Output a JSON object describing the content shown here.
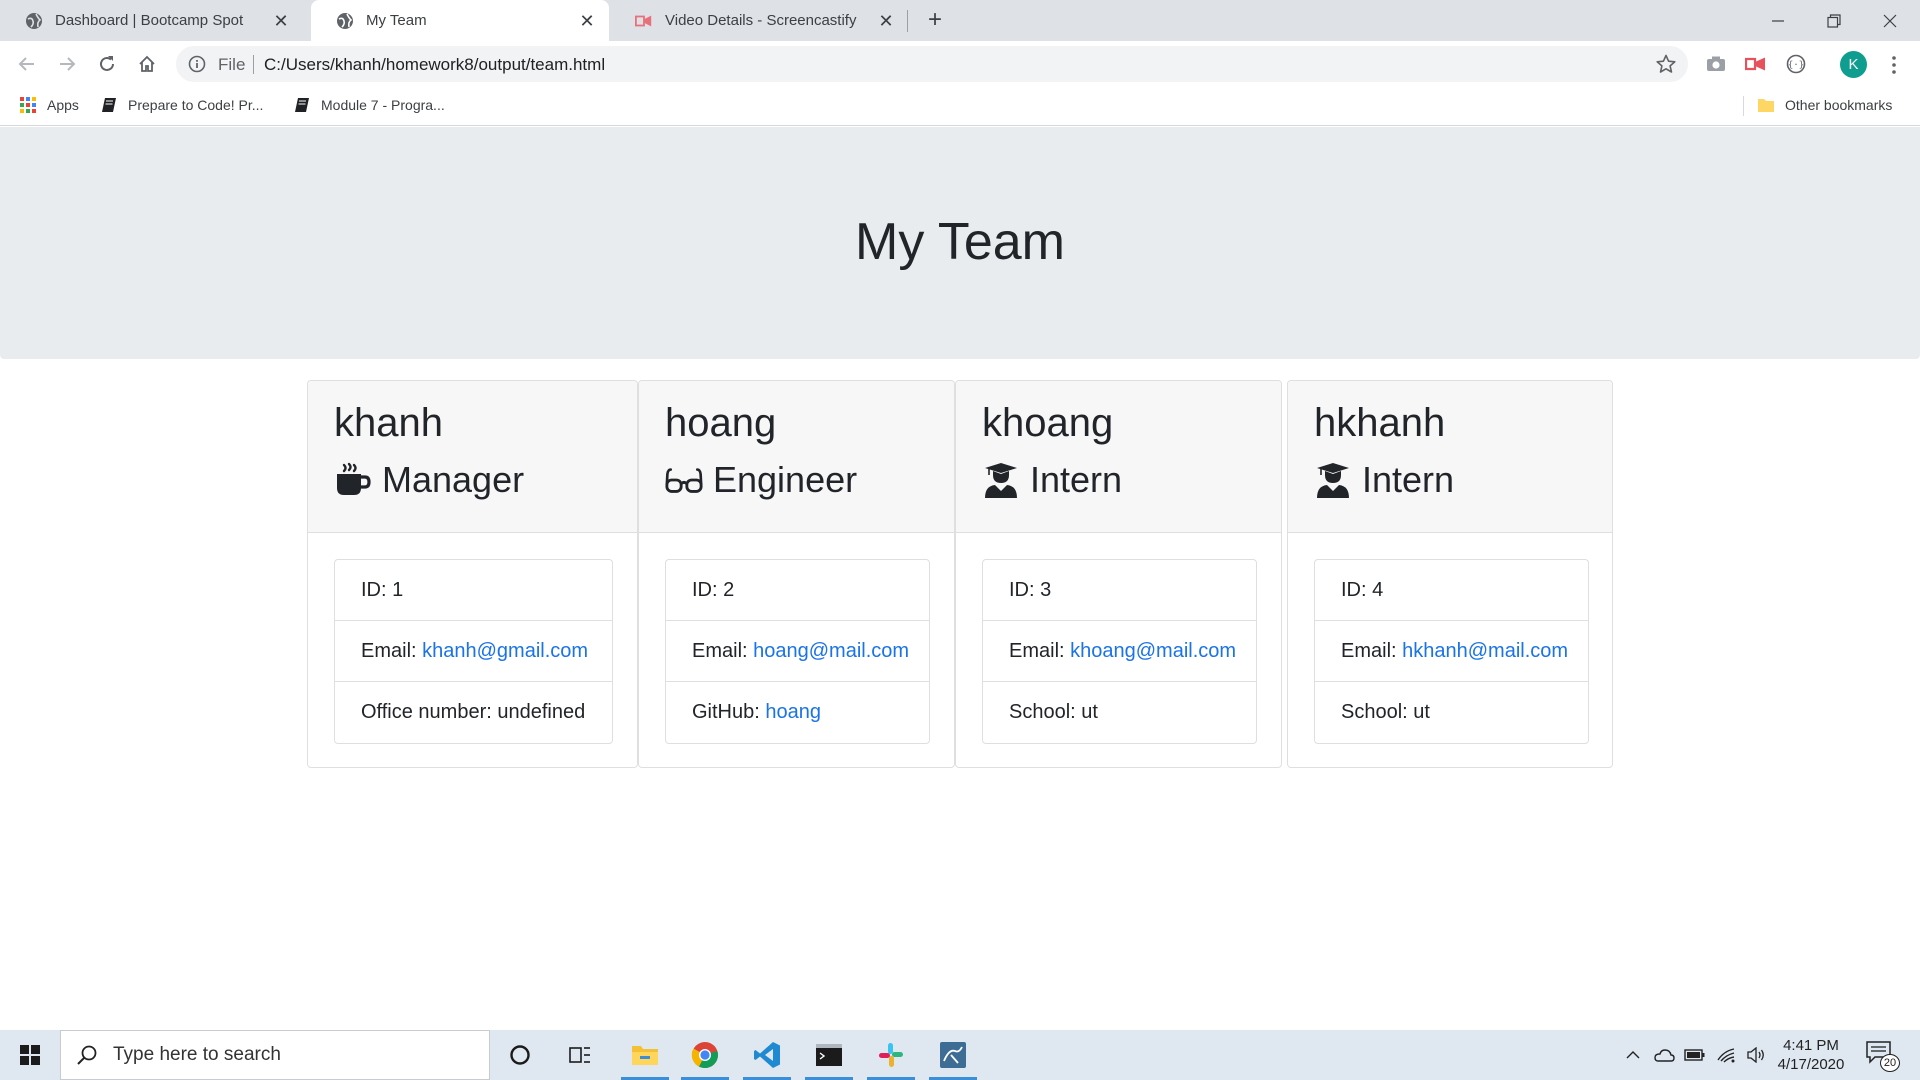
{
  "browser": {
    "tabs": [
      {
        "title": "Dashboard | Bootcamp Spot",
        "active": false
      },
      {
        "title": "My Team",
        "active": true
      },
      {
        "title": "Video Details - Screencastify",
        "active": false
      }
    ],
    "new_tab_label": "+",
    "address": {
      "scheme_label": "File",
      "url": "C:/Users/khanh/homework8/output/team.html"
    },
    "profile_initial": "K",
    "bookmarks": [
      {
        "label": "Apps",
        "icon": "apps-grid-icon"
      },
      {
        "label": "Prepare to Code! Pr...",
        "icon": "book-icon"
      },
      {
        "label": "Module 7 - Progra...",
        "icon": "book-icon"
      }
    ],
    "other_bookmarks_label": "Other bookmarks"
  },
  "page": {
    "title": "My Team",
    "employees": [
      {
        "name": "khanh",
        "role": "Manager",
        "role_icon": "coffee-mug-icon",
        "details": [
          {
            "label": "ID: ",
            "value": "1",
            "link": false
          },
          {
            "label": "Email: ",
            "value": "khanh@gmail.com",
            "link": true
          },
          {
            "label": "Office number: ",
            "value": "undefined",
            "link": false
          }
        ]
      },
      {
        "name": "hoang",
        "role": "Engineer",
        "role_icon": "glasses-icon",
        "details": [
          {
            "label": "ID: ",
            "value": "2",
            "link": false
          },
          {
            "label": "Email: ",
            "value": "hoang@mail.com",
            "link": true
          },
          {
            "label": "GitHub: ",
            "value": "hoang",
            "link": true
          }
        ]
      },
      {
        "name": "khoang",
        "role": "Intern",
        "role_icon": "graduate-icon",
        "details": [
          {
            "label": "ID: ",
            "value": "3",
            "link": false
          },
          {
            "label": "Email: ",
            "value": "khoang@mail.com",
            "link": true
          },
          {
            "label": "School: ",
            "value": "ut",
            "link": false
          }
        ]
      },
      {
        "name": "hkhanh",
        "role": "Intern",
        "role_icon": "graduate-icon",
        "details": [
          {
            "label": "ID: ",
            "value": "4",
            "link": false
          },
          {
            "label": "Email: ",
            "value": "hkhanh@mail.com",
            "link": true
          },
          {
            "label": "School: ",
            "value": "ut",
            "link": false
          }
        ]
      }
    ],
    "colors": {
      "jumbotron": "#e9ecef",
      "link": "#1a73e8",
      "card_header": "#f7f7f7"
    }
  },
  "taskbar": {
    "search_placeholder": "Type here to search",
    "apps": [
      "cortana-icon",
      "task-view-icon",
      "file-explorer-icon",
      "chrome-icon",
      "vscode-icon",
      "terminal-icon",
      "slack-icon",
      "mysql-workbench-icon"
    ],
    "time": "4:41 PM",
    "date": "4/17/2020",
    "notification_count": "20"
  }
}
